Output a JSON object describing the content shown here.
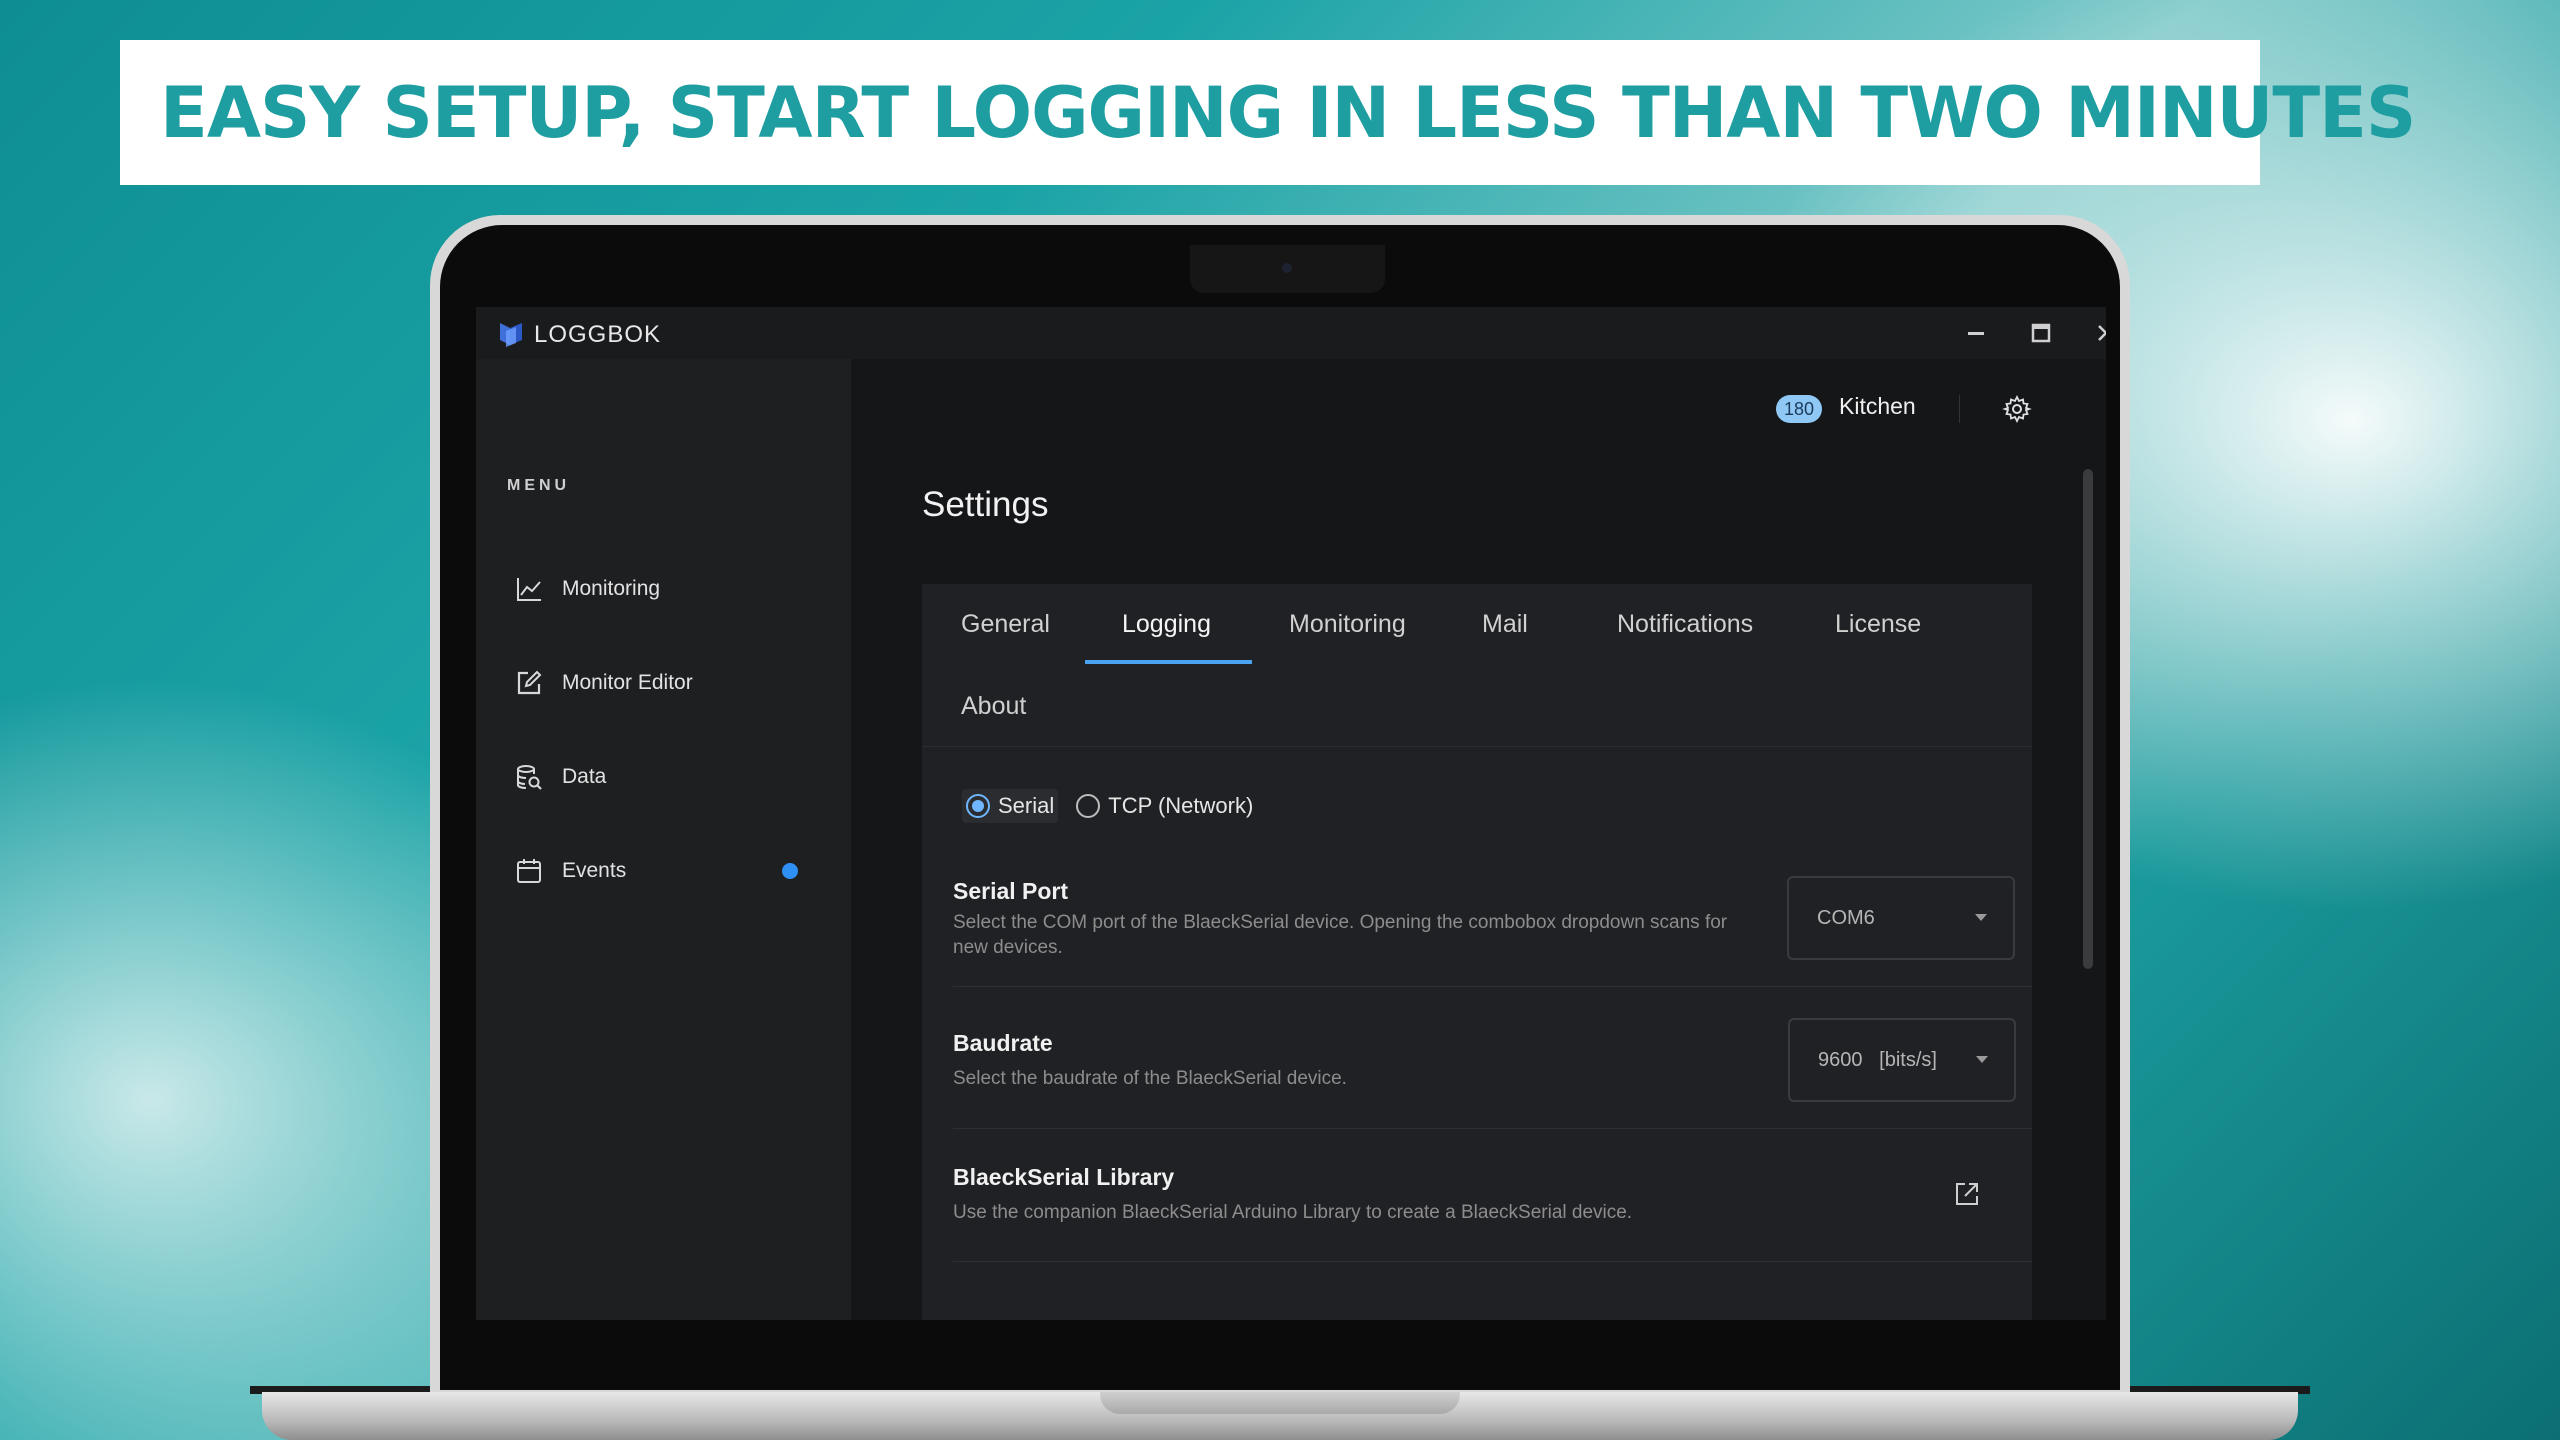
{
  "banner": {
    "headline": "EASY SETUP, START LOGGING IN LESS THAN TWO MINUTES"
  },
  "app": {
    "name": "LOGGBOK"
  },
  "window_controls": {
    "minimize": "minimize-icon",
    "maximize": "maximize-icon",
    "close": "close-icon"
  },
  "sidebar": {
    "menu_label": "MENU",
    "items": [
      {
        "label": "Monitoring",
        "icon": "line-chart-icon"
      },
      {
        "label": "Monitor Editor",
        "icon": "edit-icon"
      },
      {
        "label": "Data",
        "icon": "data-search-icon"
      },
      {
        "label": "Events",
        "icon": "calendar-icon",
        "has_indicator": true
      }
    ],
    "indicator_color": "#2e8ff5"
  },
  "topbar": {
    "badge": "180",
    "user": "Kitchen",
    "settings_icon": "gear-icon"
  },
  "page": {
    "title": "Settings"
  },
  "tabs": {
    "items": [
      "General",
      "Logging",
      "Monitoring",
      "Mail",
      "Notifications",
      "License",
      "About"
    ],
    "active": "Logging",
    "accent": "#4aa3f0"
  },
  "connection": {
    "options": [
      "Serial",
      "TCP (Network)"
    ],
    "selected": "Serial"
  },
  "settings": {
    "serial_port": {
      "title": "Serial Port",
      "description": "Select the COM port of the BlaeckSerial device. Opening the combobox dropdown scans for new devices.",
      "value": "COM6"
    },
    "baudrate": {
      "title": "Baudrate",
      "description": "Select the baudrate of the BlaeckSerial device.",
      "value": "9600   [bits/s]"
    },
    "library": {
      "title": "BlaeckSerial Library",
      "description": "Use the companion BlaeckSerial Arduino Library to create a BlaeckSerial device.",
      "icon": "external-link-icon"
    }
  }
}
